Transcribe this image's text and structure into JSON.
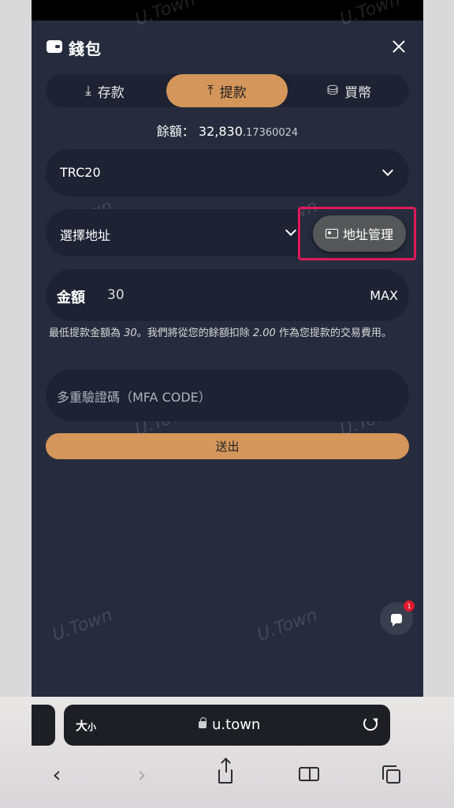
{
  "wallet": {
    "title": "錢包",
    "tabs": [
      {
        "label": "存款",
        "icon": "download-icon"
      },
      {
        "label": "提款",
        "icon": "upload-icon"
      },
      {
        "label": "買幣",
        "icon": "coins-icon"
      }
    ],
    "balance_label": "餘額：",
    "balance_main": "32,830",
    "balance_decimals": ".17360024",
    "network": "TRC20",
    "address_placeholder": "選擇地址",
    "address_manage_label": "地址管理",
    "amount_label": "金額",
    "amount_value": "30",
    "max_label": "MAX",
    "note_prefix": "最低提款金額為 ",
    "note_min": "30",
    "note_middle": "。我們將從您的餘額扣除 ",
    "note_fee": "2.00",
    "note_suffix": " 作為您提款的交易費用。",
    "mfa_placeholder": "多重驗證碼（MFA CODE）",
    "submit_label": "送出",
    "chat_badge": "1",
    "watermark": "U.Town"
  },
  "browser": {
    "text_size_big": "大",
    "text_size_small": "小",
    "url": "u.town"
  },
  "colors": {
    "background": "#262c3d",
    "field": "#1e2232",
    "accent": "#d4965a",
    "highlight_border": "#e0195a"
  }
}
